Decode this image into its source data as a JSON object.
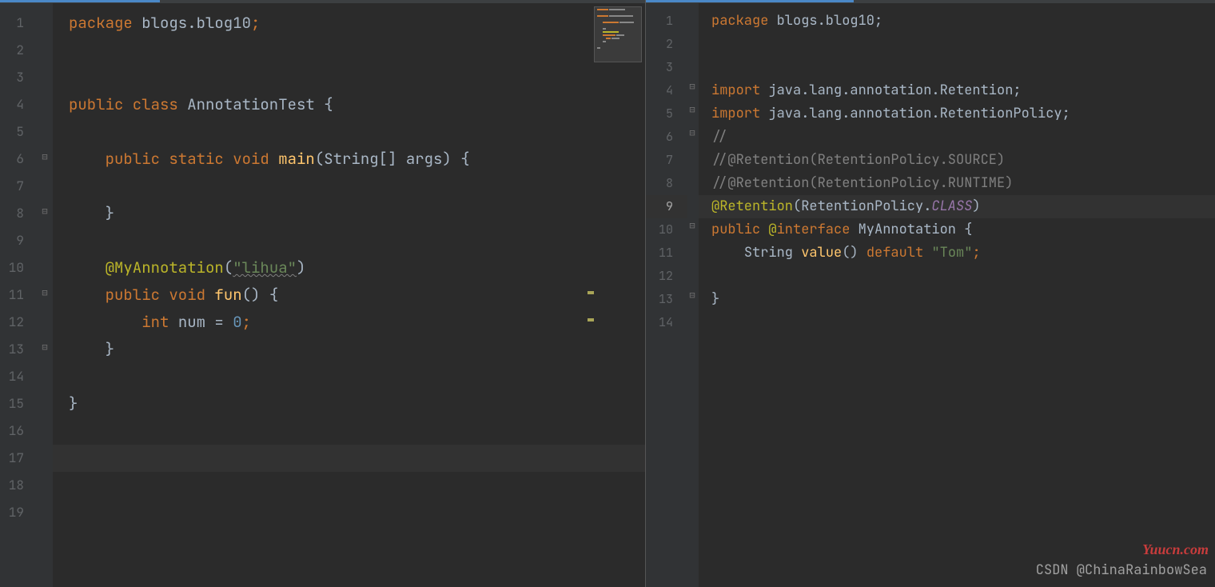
{
  "left": {
    "lines": [
      "1",
      "2",
      "3",
      "4",
      "5",
      "6",
      "7",
      "8",
      "9",
      "10",
      "11",
      "12",
      "13",
      "14",
      "15",
      "16",
      "17",
      "18",
      "19"
    ],
    "runLines": [
      4,
      6
    ],
    "currentLine": 17,
    "code": {
      "l1_package": "package ",
      "l1_pkg": "blogs.blog10",
      "l4_kw1": "public class ",
      "l4_cls": "AnnotationTest ",
      "l4_brace": "{",
      "l6_kw": "public static void ",
      "l6_fn": "main",
      "l6_args": "(String[] args) {",
      "l8_brace": "}",
      "l10_ann": "@MyAnnotation",
      "l10_paren_open": "(",
      "l10_str": "\"lihua\"",
      "l10_paren_close": ")",
      "l11_kw": "public void ",
      "l11_fn": "fun",
      "l11_rest": "() {",
      "l12_kw": "int ",
      "l12_var": "num = ",
      "l12_num": "0",
      "l12_semi": ";",
      "l13_brace": "}",
      "l15_brace": "}"
    }
  },
  "right": {
    "lines": [
      "1",
      "2",
      "3",
      "4",
      "5",
      "6",
      "7",
      "8",
      "9",
      "10",
      "11",
      "12",
      "13",
      "14"
    ],
    "currentLine": 9,
    "code": {
      "l1_package": "package ",
      "l1_pkg": "blogs.blog10;",
      "l4_kw": "import ",
      "l4_rest": "java.lang.annotation.Retention;",
      "l5_kw": "import ",
      "l5_rest": "java.lang.annotation.RetentionPolicy;",
      "l6_cmt": "//",
      "l7_cmt": "//@Retention(RetentionPolicy.SOURCE)",
      "l8_cmt": "//@Retention(RetentionPolicy.RUNTIME)",
      "l9_ann": "@Retention",
      "l9_p1": "(RetentionPolicy.",
      "l9_cls": "CLASS",
      "l9_p2": ")",
      "l10_kw1": "public ",
      "l10_at": "@",
      "l10_kw2": "interface ",
      "l10_name": "MyAnnotation {",
      "l11_type": "String ",
      "l11_fn": "value",
      "l11_p": "() ",
      "l11_kw": "default ",
      "l11_str": "\"Tom\"",
      "l11_semi": ";",
      "l13_brace": "}"
    }
  },
  "watermarks": {
    "w1": "Yuucn.com",
    "w2": "CSDN @ChinaRainbowSea"
  }
}
